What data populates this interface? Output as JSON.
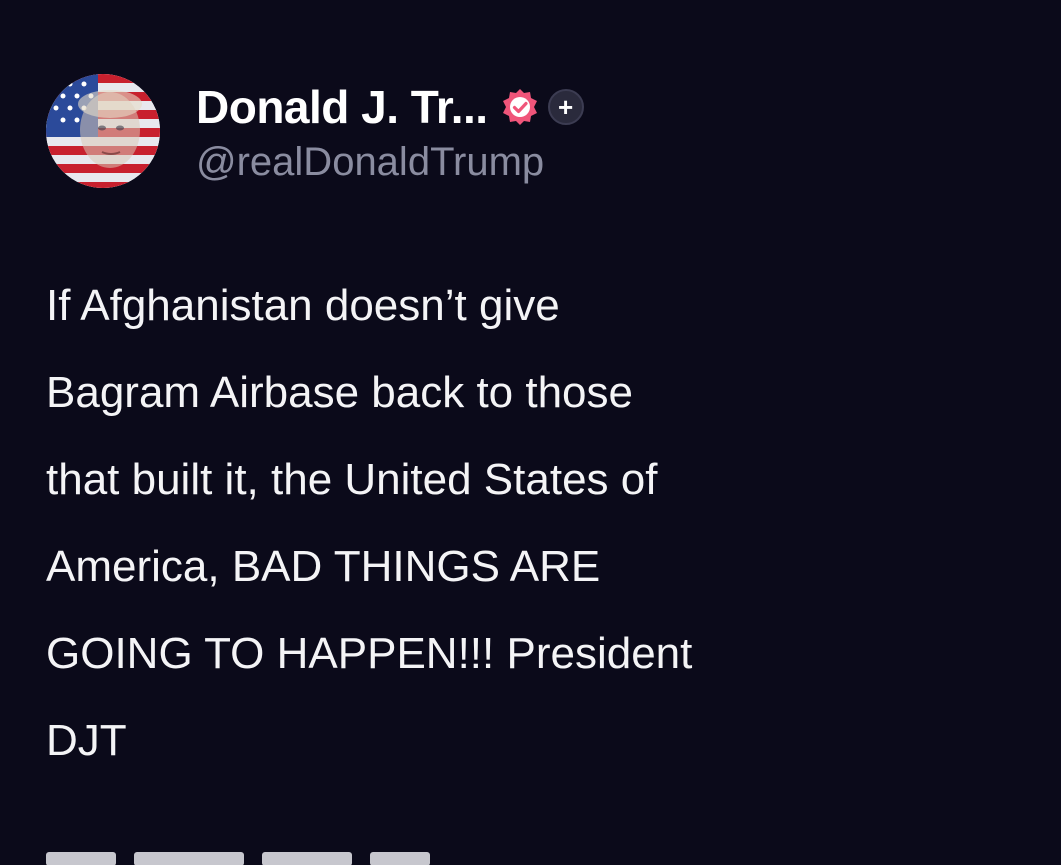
{
  "post": {
    "author": {
      "display_name": "Donald J. Tr...",
      "handle": "@realDonaldTrump",
      "verified_icon": "verified-badge-icon",
      "verified_color": "#f0557a",
      "plus_icon": "plus-icon",
      "plus_label": "+"
    },
    "text": "If Afghanistan doesn’t give\nBagram Airbase back to those\nthat built it, the United States of\nAmerica, BAD THINGS ARE\nGOING TO HAPPEN!!! President\nDJT"
  },
  "theme": {
    "background": "#0b0a1a",
    "text": "#f4f4f6",
    "muted": "#8a8ca0"
  }
}
